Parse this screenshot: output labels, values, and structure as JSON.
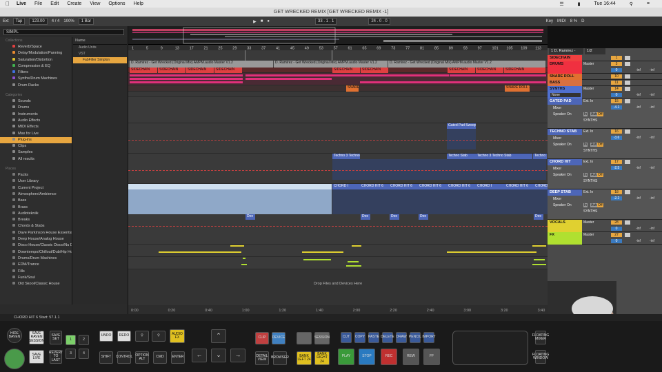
{
  "menubar": {
    "app": "Live",
    "items": [
      "File",
      "Edit",
      "Create",
      "View",
      "Options",
      "Help"
    ],
    "time": "Tue 16:44"
  },
  "window_title": "GET WRECKED REMIX  [GET WRECKED REMIX -1]",
  "transport": {
    "ext": "Ext",
    "tap": "Tap",
    "tempo": "123.00",
    "signature": "4 / 4",
    "zoom": "100%",
    "quant": "1 Bar",
    "position": "33 . 1 . 1",
    "loop_len": "24 . 0 . 0",
    "key": "Key",
    "midi": "MIDI",
    "cpu": "8 %",
    "d_label": "D"
  },
  "browser": {
    "search_value": "SIMPL",
    "collections_header": "Collections",
    "collections": [
      {
        "label": "Reverb/Space",
        "color": "#e04040"
      },
      {
        "label": "Delay/Modulation/Panning",
        "color": "#e78a30"
      },
      {
        "label": "Saturation/Distortion",
        "color": "#d8c030"
      },
      {
        "label": "Compression & EQ",
        "color": "#40b050"
      },
      {
        "label": "Filters",
        "color": "#4070e0"
      },
      {
        "label": "Synths/Drum Machines",
        "color": "#9050d0"
      },
      {
        "label": "Drum Racks",
        "color": "#888"
      }
    ],
    "categories_header": "Categories",
    "categories": [
      "Sounds",
      "Drums",
      "Instruments",
      "Audio Effects",
      "MIDI Effects",
      "Max for Live",
      "Plug-ins",
      "Clips",
      "Samples",
      "All results"
    ],
    "selected_category": "Plug-ins",
    "places_header": "Places",
    "places": [
      "Packs",
      "User Library",
      "Current Project",
      "Atmosphere/Ambience",
      "Bass",
      "Brass",
      "Audiotekniik",
      "Breaks",
      "Chords & Stabs",
      "Dave Parkinson House Essentials",
      "Deep House/Analog House",
      "Disco House/Classic Disco/Nu Disco",
      "Downtempo/Chillout/Dub/Hip Hop",
      "Drums/Drum Machines",
      "EDM/Trance",
      "Fills",
      "Funk/Soul",
      "Old Skool/Classic House"
    ],
    "file_header": "Name",
    "files": [
      "Audio Units",
      "VST",
      "FabFilter Simplon"
    ]
  },
  "ruler_bars": [
    "1",
    "5",
    "9",
    "13",
    "17",
    "21",
    "25",
    "29",
    "33",
    "37",
    "41",
    "45",
    "49",
    "53",
    "57",
    "61",
    "65",
    "69",
    "73",
    "77",
    "81",
    "85",
    "89",
    "93",
    "97",
    "101",
    "105",
    "109",
    "113"
  ],
  "time_marks": [
    "0:00",
    "0:20",
    "0:40",
    "1:00",
    "1:20",
    "1:40",
    "2:00",
    "2:20",
    "2:40",
    "3:00",
    "3:20",
    "3:40"
  ],
  "arrangement": {
    "audio_clip_labels": [
      "D. Ramirez - Get Wrecked (Original Mix) AMPM.audio Master V1.2",
      "D. Ramirez - Get Wrecked (Original Mix) AMPM.audio Master V1.2",
      "D. Ramirez - Get Wrecked (Original Mix) AMPM.audio Master V1.2"
    ],
    "sidechain": "SIDECHAIN",
    "snare": "SNARE",
    "snare_roll": "SNARE ROLL 1",
    "gated_pad": "Gated Pad Sweep",
    "techno_stab": "Techno Stab",
    "techno_stab_long": "Techno 3 Techno Stab",
    "chord_hit": "CHORD HIT 6",
    "chord_short": "CHORD I",
    "dee": "Dee",
    "drop_text": "Drop Files and Devices Here"
  },
  "mixer": {
    "header_name": "1 D. Ramirez -",
    "header_sel": "1/2",
    "tracks": [
      {
        "name": "SIDECHAIN",
        "color": "#f04040",
        "num": "1",
        "vol": "",
        "kind": "small"
      },
      {
        "name": "DRUMS",
        "color": "#f03040",
        "num": "3",
        "vol": "0",
        "kind": "group",
        "route": "Master"
      },
      {
        "name": "SNARE ROLL",
        "color": "#e07030",
        "num": "10",
        "vol": "",
        "kind": "small"
      },
      {
        "name": "BASS",
        "color": "#d87040",
        "num": "11",
        "vol": "",
        "kind": "small"
      },
      {
        "name": "SYNTHS",
        "color": "#5070d0",
        "num": "14",
        "vol": "0",
        "kind": "group",
        "route": "Master",
        "sub": "None"
      },
      {
        "name": "GATED PAD",
        "color": "#5080e0",
        "num": "15",
        "vol": "-4.1",
        "kind": "midi",
        "input": "Ext. In",
        "mon": "Mixer",
        "out": "Speaker On",
        "grp": "SYNTHS"
      },
      {
        "name": "TECHNO STAB",
        "color": "#5080e0",
        "num": "16",
        "vol": "-3.6",
        "kind": "midi",
        "input": "Ext. In",
        "mon": "Mixer",
        "out": "Speaker On",
        "grp": "SYNTHS"
      },
      {
        "name": "CHORD HIT",
        "color": "#5080e0",
        "num": "17",
        "vol": "-2.5",
        "kind": "midi",
        "input": "Ext. In",
        "mon": "Mixer",
        "out": "Speaker On",
        "grp": "SYNTHS"
      },
      {
        "name": "DEEP STAB",
        "color": "#5080e0",
        "num": "18",
        "vol": "-2.2",
        "kind": "midi",
        "input": "Ext. In",
        "mon": "Mixer",
        "out": "Speaker On",
        "grp": "SYNTHS"
      },
      {
        "name": "VOCALS",
        "color": "#e0d030",
        "num": "28",
        "vol": "0",
        "kind": "group",
        "route": "Master"
      },
      {
        "name": "FX",
        "color": "#b0e030",
        "num": "27",
        "vol": "0",
        "kind": "group",
        "route": "Master"
      }
    ],
    "inf": "-inf",
    "mon_in": "In",
    "mon_auto": "Auto",
    "mon_off": "Off"
  },
  "status": "CHORD HIT 6  Start: 57.1.1",
  "controller": {
    "side_top": "HIDE BAVEN",
    "save_raven": "SAVE RAVEN SESSION",
    "save_set": "SAVE SET",
    "save_live": "SAVE LIVE",
    "revert": "REVERT TO LAST",
    "n1": "1",
    "n2": "2",
    "n3": "3",
    "n4": "4",
    "undo": "UNDO",
    "redo": "REDO",
    "audio_fx": "AUDIO FX",
    "shift": "SHIFT",
    "control": "CONTROL",
    "option_alt": "OPTION ALT",
    "cmd": "CMD",
    "enter": "ENTER",
    "detail_view": "DETAIL VIEW",
    "browser": "BROWSER",
    "bank_left": "BANK LEFT 24",
    "bank_right": "BANK RIGHT 24",
    "play": "PLAY",
    "stop": "STOP",
    "rec": "REC",
    "rew": "REW",
    "ff": "FF",
    "floating_mixer": "FLOATING MIXER",
    "floating_window": "FLOATING WINDOW",
    "tools": [
      "CUT",
      "COPY",
      "PASTE",
      "DELETE",
      "DRAW",
      "PENCIL",
      "IMPORT"
    ],
    "clip": "CLIP",
    "device": "DEVICE",
    "session": "SESSION"
  }
}
